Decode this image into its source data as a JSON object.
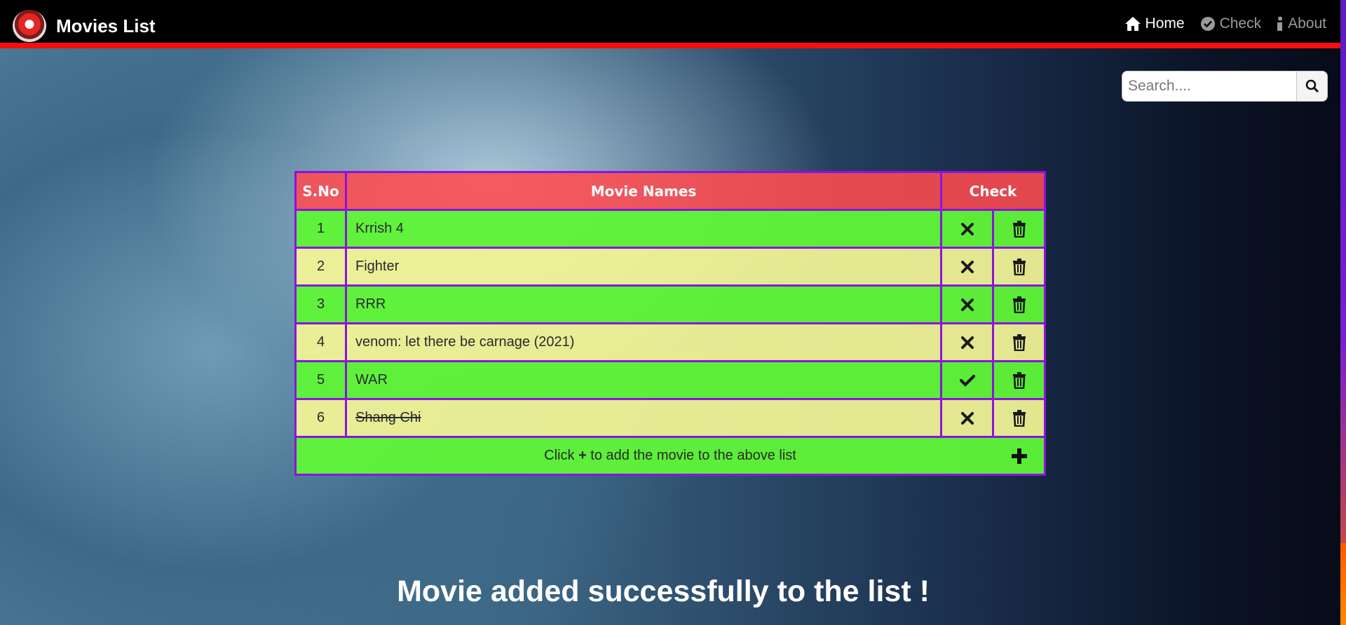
{
  "app": {
    "title": "Movies List"
  },
  "nav": {
    "items": [
      {
        "label": "Home",
        "icon": "home-icon",
        "active": true
      },
      {
        "label": "Check",
        "icon": "check-circle-icon",
        "active": false
      },
      {
        "label": "About",
        "icon": "info-icon",
        "active": false
      }
    ]
  },
  "search": {
    "placeholder": "Search...."
  },
  "table": {
    "headers": {
      "sno": "S.No",
      "name": "Movie Names",
      "check": "Check"
    },
    "rows": [
      {
        "sno": "1",
        "name": "Krrish 4",
        "checked": false
      },
      {
        "sno": "2",
        "name": "Fighter",
        "checked": false
      },
      {
        "sno": "3",
        "name": "RRR",
        "checked": false
      },
      {
        "sno": "4",
        "name": "venom: let there be carnage (2021)",
        "checked": false
      },
      {
        "sno": "5",
        "name": "WAR",
        "checked": true
      },
      {
        "sno": "6",
        "name": "Shang Chi",
        "checked": false,
        "struck": true
      }
    ],
    "footer": {
      "prefix": "Click ",
      "plus": "+",
      "suffix": " to add the movie to the above list"
    }
  },
  "toast": "Movie added successfully to the list !",
  "colors": {
    "navbar": "#000000",
    "nav_border": "#ff0d0d",
    "header_bg": "#ff4b50",
    "row_green": "#5ff537",
    "row_yellow": "#f3f596",
    "table_border": "#8a14e0"
  }
}
